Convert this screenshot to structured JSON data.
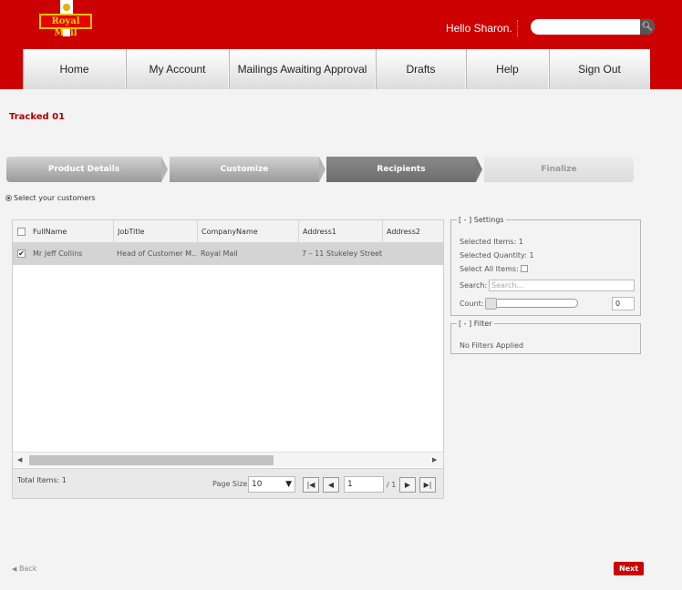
{
  "brand": {
    "logo_text": "Royal Mail"
  },
  "header": {
    "greeting": "Hello Sharon.",
    "search_placeholder": ""
  },
  "nav": {
    "items": [
      "Home",
      "My Account",
      "Mailings Awaiting Approval",
      "Drafts",
      "Help",
      "Sign Out"
    ]
  },
  "page": {
    "title": "Tracked 01"
  },
  "steps": {
    "items": [
      "Product Details",
      "Customize",
      "Recipients",
      "Finalize"
    ],
    "active": "Recipients"
  },
  "select_label": "Select your customers",
  "grid": {
    "columns": [
      "FullName",
      "JobTitle",
      "CompanyName",
      "Address1",
      "Address2"
    ],
    "rows": [
      {
        "checked": true,
        "cells": [
          "Mr Jeff Collins",
          "Head of Customer M...",
          "Royal Mail",
          "7 – 11 Stukeley Street",
          ""
        ]
      }
    ],
    "total_items": "Total Items: 1",
    "page_size_label": "Page Size:",
    "page_size": "10",
    "page_number": "1",
    "page_of": "/ 1"
  },
  "settings": {
    "legend": "[ - ] Settings",
    "selected_items": "Selected Items: 1",
    "selected_quantity": "Selected Quantity: 1",
    "select_all_label": "Select All Items:",
    "search_label": "Search:",
    "search_placeholder": "Search...",
    "count_label": "Count:",
    "count_value": "0"
  },
  "filter": {
    "legend": "[ - ] Filter",
    "text": "No Filters Applied"
  },
  "footer": {
    "back": "Back",
    "next": "Next"
  },
  "colors": {
    "brand_red": "#cc0000",
    "active_step": "#777777"
  }
}
